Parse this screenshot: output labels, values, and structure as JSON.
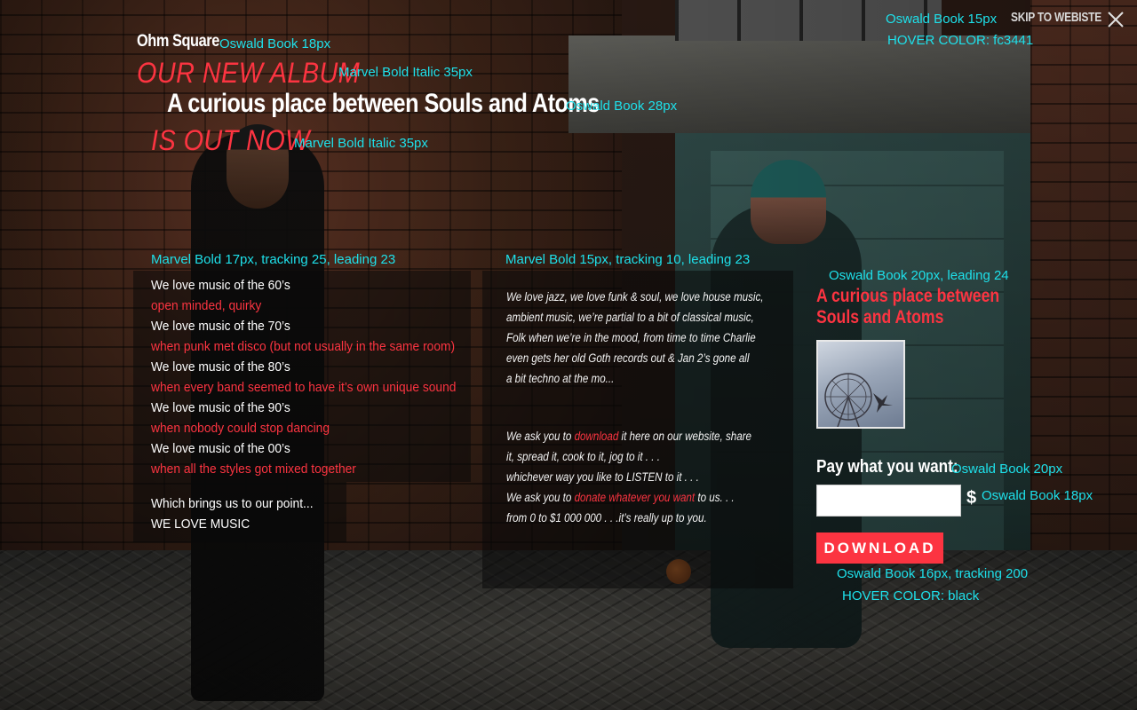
{
  "header": {
    "brand": "Ohm Square",
    "brand_note": "Oswald  Book 18px",
    "skip_note": "Oswald  Book 15px",
    "skip_hover_note": "HOVER COLOR: fc3441",
    "skip_label": "SKIP TO WEBISTE",
    "close_icon": "close-icon"
  },
  "headline": {
    "line1": "OUR NEW ALBUM",
    "line1_note": "Marvel Bold Italic 35px",
    "album_title": "A curious place between Souls and Atoms",
    "album_title_note": "Oswald  Book 28px",
    "line3": "IS OUT NOW",
    "line3_note": "Marvel Bold Italic 35px"
  },
  "list_section": {
    "note": "Marvel Bold 17px, tracking 25, leading 23",
    "items": [
      {
        "text": "We love music of the 60’s",
        "color": "white"
      },
      {
        "text": "open minded, quirky",
        "color": "red"
      },
      {
        "text": "We love music of the 70’s",
        "color": "white"
      },
      {
        "text": "when punk met disco (but not usually in the same room)",
        "color": "red"
      },
      {
        "text": "We love music of the 80’s",
        "color": "white"
      },
      {
        "text": "when every band seemed to have it’s own unique sound",
        "color": "red"
      },
      {
        "text": "We love music of the 90’s",
        "color": "white"
      },
      {
        "text": "when nobody could stop dancing",
        "color": "red"
      },
      {
        "text": "We love music of the 00’s",
        "color": "white"
      },
      {
        "text": "when all the styles got mixed together",
        "color": "red"
      }
    ],
    "closing_1": "Which brings us to our point...",
    "closing_2": "WE LOVE MUSIC"
  },
  "middle_section": {
    "note": "Marvel Bold 15px, tracking 10, leading 23",
    "para1": [
      "We love jazz, we love funk & soul, we love house music,",
      "ambient music, we’re partial to a bit of classical music,",
      "Folk when we’re in the mood, from time to time Charlie",
      "even gets her old Goth records out & Jan 2’s gone all",
      "a bit techno at the mo..."
    ],
    "p2_l1_a": "We ask you to ",
    "p2_l1_link": "download",
    "p2_l1_b": " it here on our website, share",
    "p2_l2": "it, spread it, cook to it, jog to it . . .",
    "p2_l3": "whichever way you like to LISTEN to it . . .",
    "p2_l4_a": "We ask you to ",
    "p2_l4_link": "donate whatever you want",
    "p2_l4_b": " to us. . .",
    "p2_l5": "from  0 to $1 000 000 . . .it’s really up to you."
  },
  "product": {
    "note": "Oswald  Book 20px, leading 24",
    "title_line1": "A curious place between",
    "title_line2": "Souls and Atoms",
    "cover_icon": "album-cover-ferris-wheel",
    "pay_label": "Pay what you want:",
    "pay_label_note": "Oswald  Book 20px",
    "amount_value": "",
    "currency": "$",
    "currency_note": "Oswald  Book 18px",
    "download_label": "DOWNLOAD",
    "download_note": "Oswald  Book 16px, tracking 200",
    "download_hover_note": "HOVER COLOR: black"
  },
  "colors": {
    "accent": "#fc3441",
    "annotation": "#1ee0ea",
    "text": "#ffffff"
  }
}
